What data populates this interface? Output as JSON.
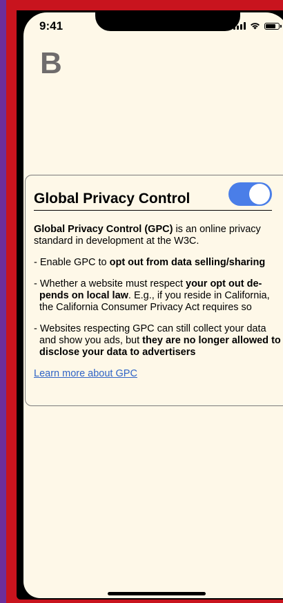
{
  "status_bar": {
    "time": "9:41"
  },
  "app": {
    "logo_letter": "B"
  },
  "gpc_card": {
    "title": "Global Privacy Control",
    "toggle_on": true,
    "intro_bold": "Global Privacy Control (GPC)",
    "intro_rest": " is an online privacy standard in development at the W3C.",
    "bullet1_pre": "- Enable GPC to ",
    "bullet1_bold": "opt out from data selling/sharing",
    "bullet2_pre": "- Whether a website must respect ",
    "bullet2_bold": "your opt out de-pends on local law",
    "bullet2_post": ". E.g., if you reside in California, the California Consumer Privacy Act requires so",
    "bullet3_pre": "- Websites respecting GPC can still collect your data and show you ads, but ",
    "bullet3_bold": "they are no longer allowed to disclose your data to advertisers",
    "learn_more": "Learn more about GPC"
  },
  "colors": {
    "toggle_active": "#4a7ee8",
    "link": "#2f63c6",
    "screen_bg": "#fef8e8",
    "frame_red": "#c8141e",
    "page_purple": "#6d2e9c"
  }
}
